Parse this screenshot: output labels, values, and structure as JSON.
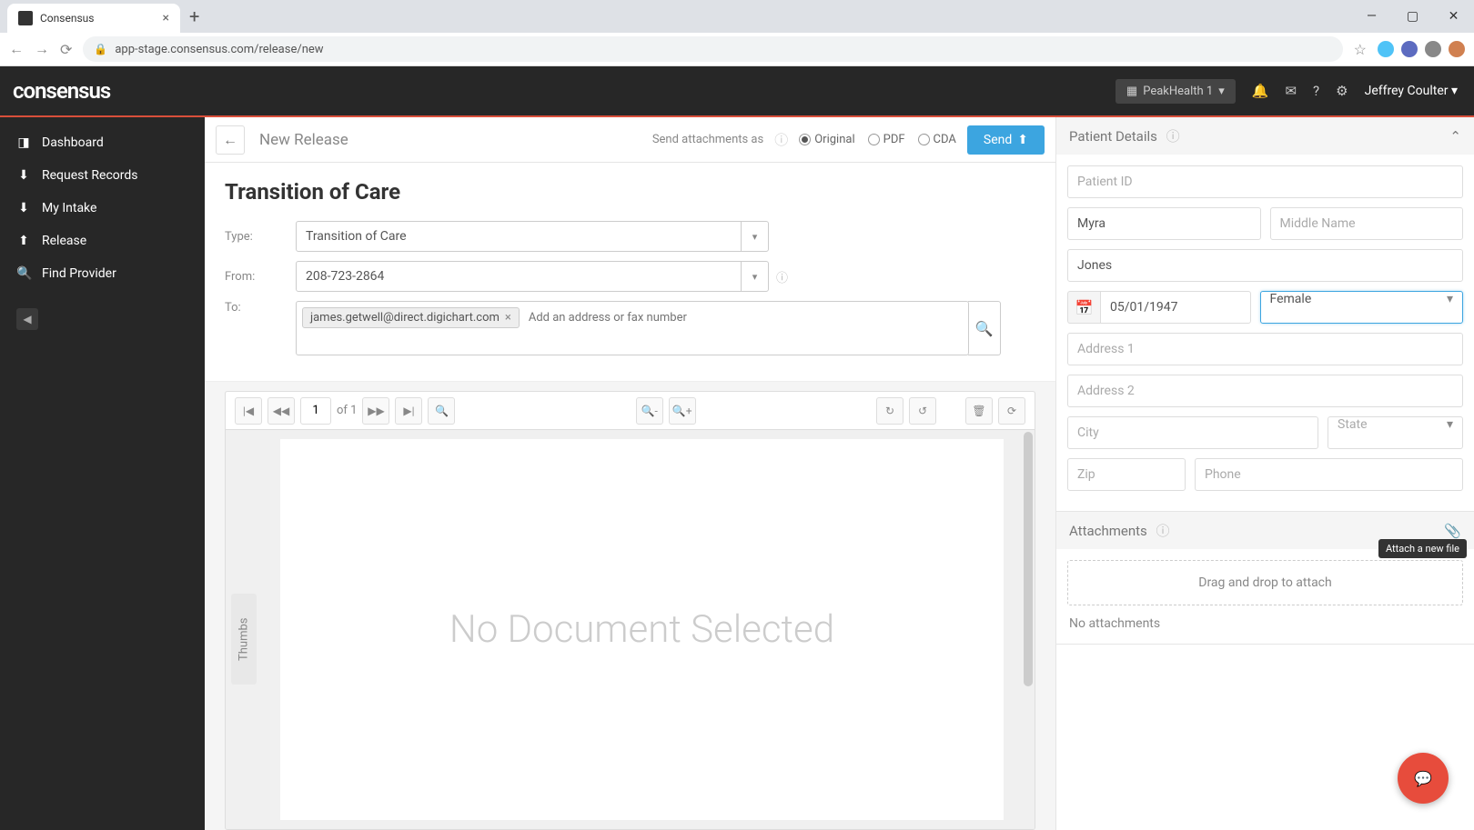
{
  "browser": {
    "tab_title": "Consensus",
    "new_tab": "+",
    "url": "app-stage.consensus.com/release/new"
  },
  "top": {
    "logo": "consensus",
    "org": "PeakHealth 1",
    "user": "Jeffrey Coulter"
  },
  "sidebar": {
    "items": [
      {
        "icon": "📊",
        "label": "Dashboard"
      },
      {
        "icon": "⬇",
        "label": "Request Records"
      },
      {
        "icon": "📥",
        "label": "My Intake"
      },
      {
        "icon": "📤",
        "label": "Release"
      },
      {
        "icon": "🔍",
        "label": "Find Provider"
      }
    ]
  },
  "header": {
    "page_name": "New Release",
    "send_as": "Send attachments as",
    "radios": {
      "original": "Original",
      "pdf": "PDF",
      "cda": "CDA"
    },
    "send_btn": "Send"
  },
  "form": {
    "title": "Transition of Care",
    "type_label": "Type:",
    "type_value": "Transition of Care",
    "from_label": "From:",
    "from_value": "208-723-2864",
    "to_label": "To:",
    "to_chip": "james.getwell@direct.digichart.com",
    "to_placeholder": "Add an address or fax number"
  },
  "viewer": {
    "page_num": "1",
    "page_of": "of 1",
    "thumbs": "Thumbs",
    "no_doc": "No Document Selected"
  },
  "patient": {
    "header": "Patient Details",
    "fields": {
      "patient_id": "Patient ID",
      "first_name": "Myra",
      "middle_name": "Middle Name",
      "last_name": "Jones",
      "dob": "05/01/1947",
      "gender": "Female",
      "address1": "Address 1",
      "address2": "Address 2",
      "city": "City",
      "state": "State",
      "zip": "Zip",
      "phone": "Phone"
    }
  },
  "attachments": {
    "header": "Attachments",
    "drop": "Drag and drop to attach",
    "none": "No attachments",
    "tooltip": "Attach a new file"
  }
}
